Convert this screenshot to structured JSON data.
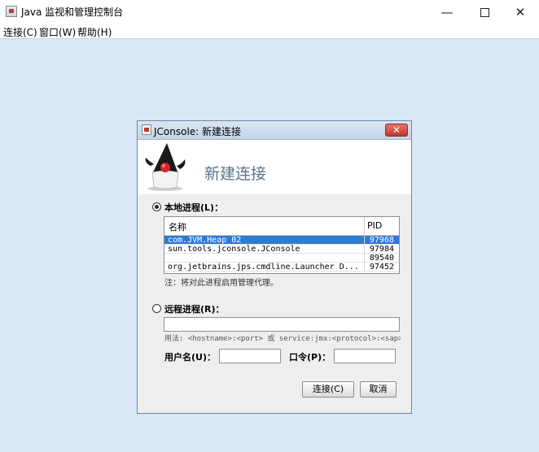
{
  "window": {
    "title": "Java 监视和管理控制台",
    "controls": {
      "minimize": "—",
      "close": "✕"
    }
  },
  "menu": [
    "连接(C)",
    "窗口(W)",
    "帮助(H)"
  ],
  "dialog": {
    "title": "JConsole: 新建连接",
    "close_glyph": "✕",
    "header": "新建连接",
    "local": {
      "label": "本地进程(L)：",
      "selected": true,
      "columns": {
        "name": "名称",
        "pid": "PID"
      },
      "rows": [
        {
          "name": "com.JVM.Heap_02",
          "pid": "97968",
          "selected": true
        },
        {
          "name": "sun.tools.jconsole.JConsole",
          "pid": "97984",
          "selected": false
        },
        {
          "name": "",
          "pid": "89540",
          "selected": false
        },
        {
          "name": "org.jetbrains.jps.cmdline.Launcher D...",
          "pid": "97452",
          "selected": false
        }
      ],
      "note": "注：将对此进程启用管理代理。"
    },
    "remote": {
      "label": "远程进程(R)：",
      "selected": false,
      "value": "",
      "usage": "用法: <hostname>:<port> 或 service:jmx:<protocol>:<sap>"
    },
    "username_label": "用户名(U)：",
    "username_value": "",
    "password_label": "口令(P)：",
    "password_value": "",
    "buttons": {
      "connect": "连接(C)",
      "cancel": "取消"
    }
  }
}
